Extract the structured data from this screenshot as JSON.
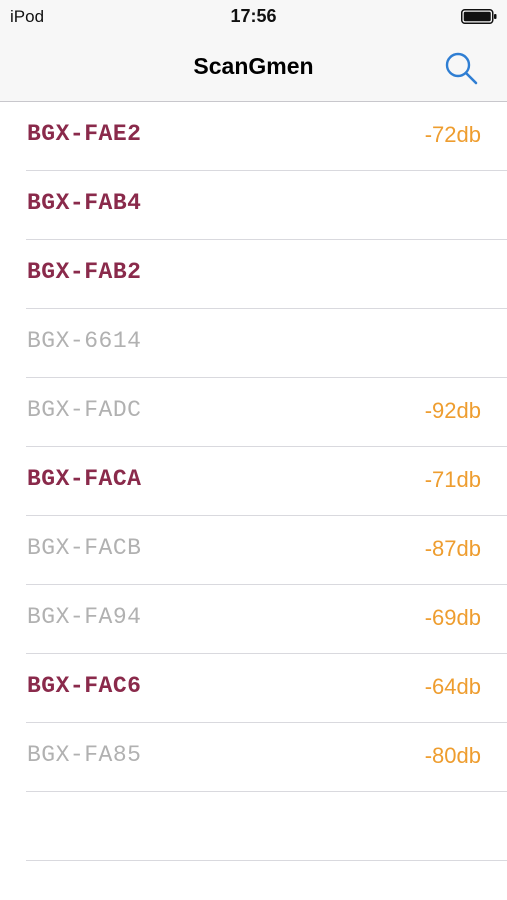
{
  "status_bar": {
    "carrier": "iPod",
    "time": "17:56",
    "battery_icon": "battery-full-icon"
  },
  "nav_bar": {
    "title": "ScanGmen",
    "search_icon": "search-icon"
  },
  "colors": {
    "active_name": "#8a2a4b",
    "inactive_name": "#b1b1b1",
    "rssi": "#ee9d2f",
    "accent": "#2f7ed3"
  },
  "devices": [
    {
      "name": "BGX-FAE2",
      "rssi": "-72db",
      "state": "active"
    },
    {
      "name": "BGX-FAB4",
      "rssi": "",
      "state": "active"
    },
    {
      "name": "BGX-FAB2",
      "rssi": "",
      "state": "active"
    },
    {
      "name": "BGX-6614",
      "rssi": "",
      "state": "inactive"
    },
    {
      "name": "BGX-FADC",
      "rssi": "-92db",
      "state": "inactive"
    },
    {
      "name": "BGX-FACA",
      "rssi": "-71db",
      "state": "active"
    },
    {
      "name": "BGX-FACB",
      "rssi": "-87db",
      "state": "inactive"
    },
    {
      "name": "BGX-FA94",
      "rssi": "-69db",
      "state": "inactive"
    },
    {
      "name": "BGX-FAC6",
      "rssi": "-64db",
      "state": "active"
    },
    {
      "name": "BGX-FA85",
      "rssi": "-80db",
      "state": "inactive"
    }
  ]
}
